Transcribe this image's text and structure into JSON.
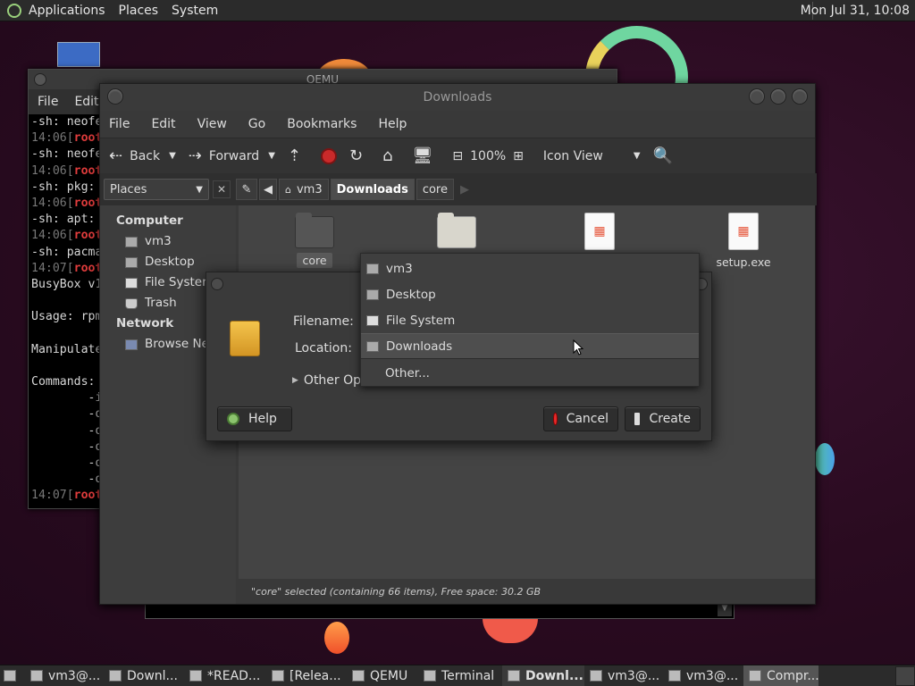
{
  "top_panel": {
    "menus": [
      "Applications",
      "Places",
      "System"
    ],
    "clock": "Mon Jul 31, 10:08"
  },
  "terminal": {
    "title": "QEMU",
    "menus": [
      "File",
      "Edit"
    ],
    "lines": [
      {
        "t": "-sh: neofe",
        "cls": ""
      },
      {
        "t": "14:06[",
        "cls": "dim",
        "r": "root"
      },
      {
        "t": "-sh: neofe",
        "cls": ""
      },
      {
        "t": "14:06[",
        "cls": "dim",
        "r": "root"
      },
      {
        "t": "-sh: pkg: ",
        "cls": ""
      },
      {
        "t": "14:06[",
        "cls": "dim",
        "r": "root"
      },
      {
        "t": "-sh: apt: ",
        "cls": ""
      },
      {
        "t": "14:06[",
        "cls": "dim",
        "r": "root"
      },
      {
        "t": "-sh: pacma",
        "cls": ""
      },
      {
        "t": "14:07[",
        "cls": "dim",
        "r": "root"
      },
      {
        "t": "BusyBox v1",
        "cls": ""
      },
      {
        "t": "",
        "cls": ""
      },
      {
        "t": "Usage: rpm",
        "cls": ""
      },
      {
        "t": "",
        "cls": ""
      },
      {
        "t": "Manipulate",
        "cls": ""
      },
      {
        "t": "",
        "cls": ""
      },
      {
        "t": "Commands:",
        "cls": ""
      },
      {
        "t": "        -i",
        "cls": ""
      },
      {
        "t": "        -q",
        "cls": ""
      },
      {
        "t": "        -q",
        "cls": ""
      },
      {
        "t": "        -q",
        "cls": ""
      },
      {
        "t": "        -q",
        "cls": ""
      },
      {
        "t": "        -q",
        "cls": ""
      },
      {
        "t": "14:07[",
        "cls": "dim",
        "r": "root"
      }
    ]
  },
  "file_manager": {
    "title": "Downloads",
    "menus": [
      "File",
      "Edit",
      "View",
      "Go",
      "Bookmarks",
      "Help"
    ],
    "toolbar": {
      "back": "Back",
      "forward": "Forward",
      "zoom": "100%",
      "view_mode": "Icon View"
    },
    "places_combo": "Places",
    "breadcrumbs": [
      "vm3",
      "Downloads",
      "core"
    ],
    "sidebar": {
      "computer_heading": "Computer",
      "computer_items": [
        "vm3",
        "Desktop",
        "File System",
        "Trash"
      ],
      "network_heading": "Network",
      "network_items": [
        "Browse Network"
      ]
    },
    "files": [
      {
        "name": "core",
        "kind": "folder-dark",
        "selected": true
      },
      {
        "name": "",
        "kind": "folder-light"
      },
      {
        "name": "",
        "kind": "doc"
      },
      {
        "name": "setup.exe",
        "kind": "doc"
      }
    ],
    "status": "\"core\" selected (containing 66 items), Free space: 30.2 GB"
  },
  "dialog": {
    "filename_label": "Filename:",
    "location_label": "Location:",
    "other_options": "Other Opti",
    "help_button": "Help",
    "cancel_button": "Cancel",
    "create_button": "Create"
  },
  "location_popup": {
    "items": [
      "vm3",
      "Desktop",
      "File System",
      "Downloads"
    ],
    "highlighted": "Downloads",
    "other": "Other..."
  },
  "taskbar": {
    "tasks": [
      {
        "label": "vm3@...",
        "state": ""
      },
      {
        "label": "Downl...",
        "state": ""
      },
      {
        "label": "*READ...",
        "state": ""
      },
      {
        "label": "[Relea...",
        "state": ""
      },
      {
        "label": "QEMU",
        "state": ""
      },
      {
        "label": "Terminal",
        "state": ""
      },
      {
        "label": "Downl...",
        "state": "active"
      },
      {
        "label": "vm3@...",
        "state": ""
      },
      {
        "label": "vm3@...",
        "state": ""
      },
      {
        "label": "Compr...",
        "state": "pressed"
      }
    ]
  },
  "colors": {
    "terminal_prompt_user": "#e03c3c",
    "stop_button": "#c92a2a",
    "cancel_icon": "#e62a2a",
    "help_icon": "#8cc46e"
  }
}
